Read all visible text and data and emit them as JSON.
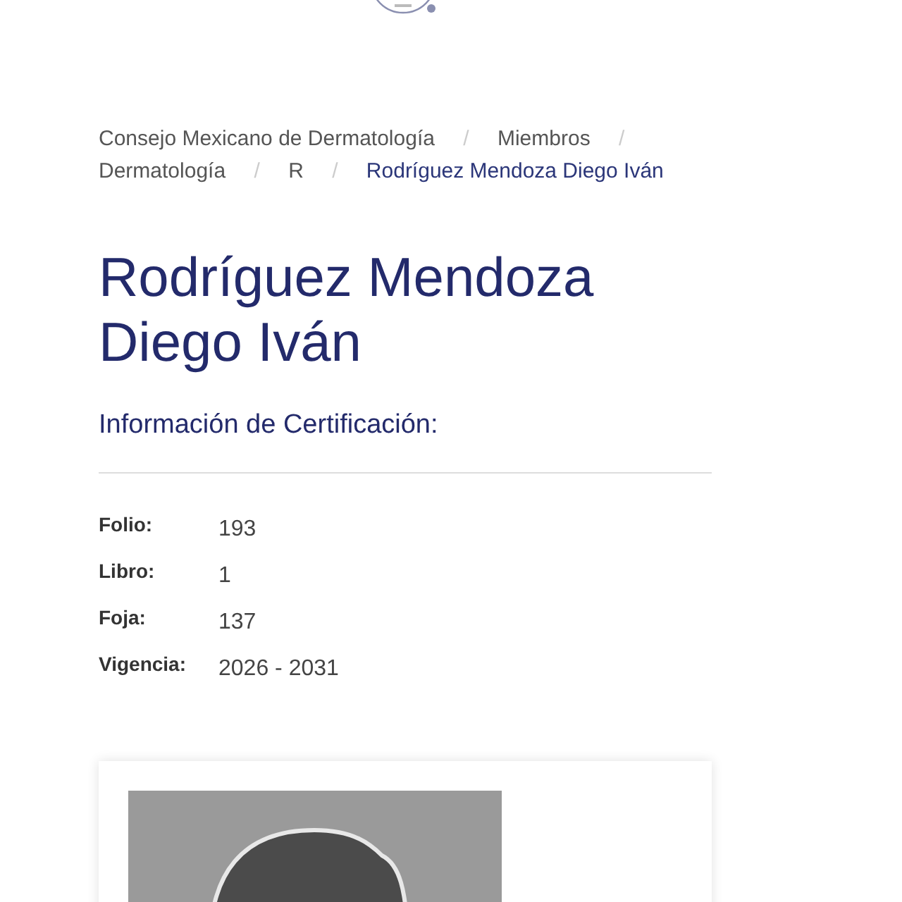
{
  "breadcrumb": {
    "separator": "/",
    "items": [
      {
        "label": "Consejo Mexicano de Dermatología",
        "current": false
      },
      {
        "label": "Miembros",
        "current": false
      },
      {
        "label": "Dermatología",
        "current": false
      },
      {
        "label": "R",
        "current": false
      },
      {
        "label": "Rodríguez Mendoza Diego Iván",
        "current": true
      }
    ]
  },
  "title": "Rodríguez Mendoza Diego Iván",
  "subtitle": "Información de Certificación:",
  "fields": [
    {
      "label": "Folio:",
      "value": "193"
    },
    {
      "label": "Libro:",
      "value": "1"
    },
    {
      "label": "Foja:",
      "value": "137"
    },
    {
      "label": "Vigencia:",
      "value": "2026 - 2031"
    }
  ]
}
